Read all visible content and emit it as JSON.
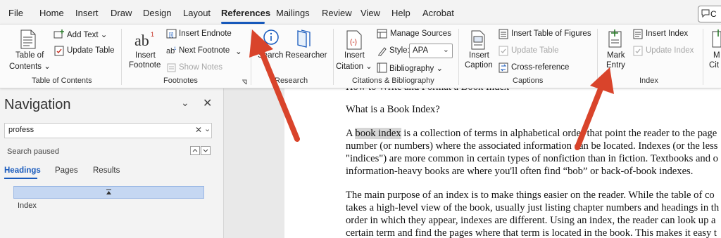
{
  "menubar": {
    "items": [
      "File",
      "Home",
      "Insert",
      "Draw",
      "Design",
      "Layout",
      "References",
      "Mailings",
      "Review",
      "View",
      "Help",
      "Acrobat"
    ],
    "active": "References",
    "comments_label": "C"
  },
  "ribbon": {
    "toc": {
      "toc_label1": "Table of",
      "toc_label2": "Contents ⌄",
      "add_text": "Add Text ⌄",
      "update_table": "Update Table",
      "group": "Table of Contents"
    },
    "footnotes": {
      "insert_footnote1": "Insert",
      "insert_footnote2": "Footnote",
      "insert_endnote": "Insert Endnote",
      "next_footnote": "Next Footnote",
      "show_notes": "Show Notes",
      "group": "Footnotes"
    },
    "research": {
      "search": "Search",
      "researcher": "Researcher",
      "group": "Research"
    },
    "citations": {
      "insert_citation1": "Insert",
      "insert_citation2": "Citation ⌄",
      "manage_sources": "Manage Sources",
      "style_label": "Style:",
      "style_value": "APA",
      "bibliography": "Bibliography ⌄",
      "group": "Citations & Bibliography"
    },
    "captions": {
      "insert_caption1": "Insert",
      "insert_caption2": "Caption",
      "insert_tof": "Insert Table of Figures",
      "update_table": "Update Table",
      "cross_reference": "Cross-reference",
      "group": "Captions"
    },
    "index": {
      "mark_entry1": "Mark",
      "mark_entry2": "Entry",
      "insert_index": "Insert Index",
      "update_index": "Update Index",
      "group": "Index"
    },
    "overflow": {
      "label1": "M",
      "label2": "Cit"
    }
  },
  "navigation": {
    "title": "Navigation",
    "search_value": "profess",
    "status": "Search paused",
    "tabs": [
      "Headings",
      "Pages",
      "Results"
    ],
    "selected_tab": "Headings",
    "heading_item": "Index"
  },
  "document": {
    "partial_heading": "How to Write and Format a Book Index",
    "heading": "What is a Book Index?",
    "p1": {
      "pre": "A ",
      "highlight": "book index",
      "post": " is a collection of terms in alphabetical order that point the reader to the page",
      "lines": [
        "number (or numbers) where the associated information can be located. Indexes (or the less",
        "\"indices\") are more common in certain types of nonfiction than in fiction. Textbooks and o",
        "information-heavy books are where you'll often find “bob” or back-of-book indexes."
      ]
    },
    "p2": [
      "The main purpose of an index is to make things easier on the reader. While the table of co",
      "takes a high-level view of the book, usually just listing chapter numbers and headings in th",
      "order in which they appear, indexes are different. Using an index, the reader can look up a",
      "certain term and find the pages where that term is located in the book. This makes it easy t"
    ]
  },
  "colors": {
    "accent": "#185abd",
    "arrow": "#d9442b",
    "highlight": "#d6d6d6"
  }
}
